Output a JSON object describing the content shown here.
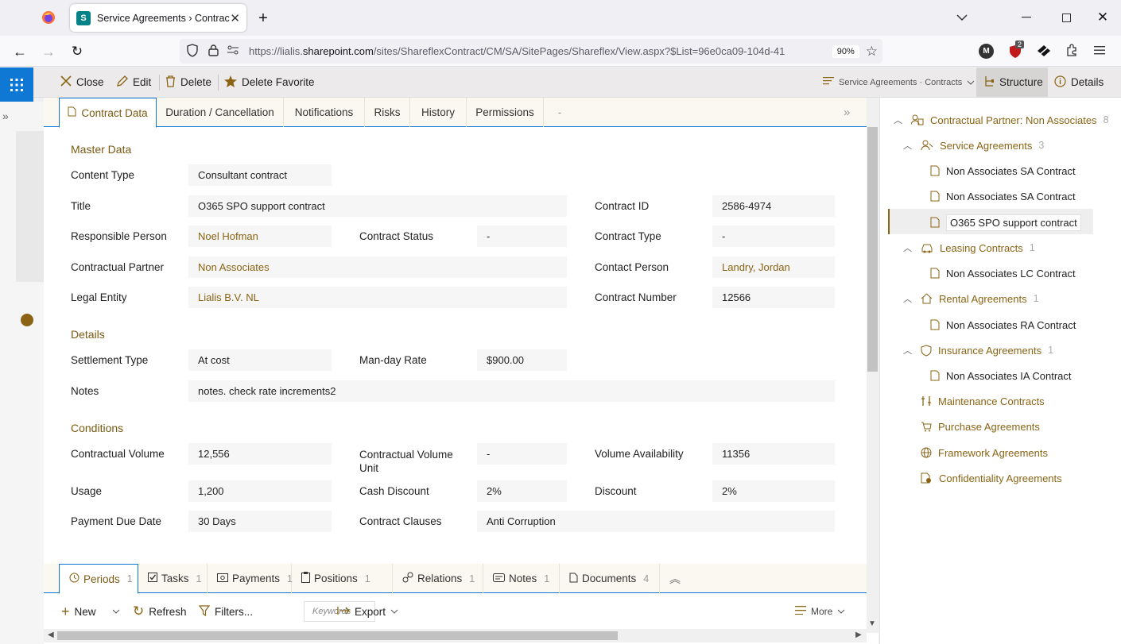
{
  "browser": {
    "tab_title": "Service Agreements › Contracts",
    "url_prefix": "https://lialis.",
    "url_domain": "sharepoint.com",
    "url_rest": "/sites/ShareflexContract/CM/SA/SitePages/Shareflex/View.aspx?$List=96e0ca09-104d-41",
    "zoom": "90%",
    "profile_initial": "M",
    "ext_badge": "2"
  },
  "command_bar": {
    "close": "Close",
    "edit": "Edit",
    "delete": "Delete",
    "delete_favorite": "Delete Favorite",
    "breadcrumb": "Service Agreements · Contracts",
    "structure": "Structure",
    "details": "Details"
  },
  "tabs": [
    "Contract Data",
    "Duration / Cancellation",
    "Notifications",
    "Risks",
    "History",
    "Permissions",
    "-"
  ],
  "sections": {
    "master": "Master Data",
    "details": "Details",
    "conditions": "Conditions"
  },
  "fields": {
    "content_type": {
      "label": "Content Type",
      "value": "Consultant contract"
    },
    "title": {
      "label": "Title",
      "value": "O365 SPO support contract"
    },
    "contract_id": {
      "label": "Contract ID",
      "value": "2586-4974"
    },
    "responsible_person": {
      "label": "Responsible Person",
      "value": "Noel Hofman"
    },
    "contract_status": {
      "label": "Contract Status",
      "value": "-"
    },
    "contract_type": {
      "label": "Contract Type",
      "value": "-"
    },
    "contractual_partner": {
      "label": "Contractual Partner",
      "value": "Non Associates"
    },
    "contact_person": {
      "label": "Contact Person",
      "value": "Landry, Jordan"
    },
    "legal_entity": {
      "label": "Legal Entity",
      "value": "Lialis B.V. NL"
    },
    "contract_number": {
      "label": "Contract Number",
      "value": "12566"
    },
    "settlement_type": {
      "label": "Settlement Type",
      "value": "At cost"
    },
    "man_day_rate": {
      "label": "Man-day Rate",
      "value": "$900.00"
    },
    "notes": {
      "label": "Notes",
      "value": "notes. check rate increments2"
    },
    "contractual_volume": {
      "label": "Contractual Volume",
      "value": "12,556"
    },
    "contractual_volume_unit": {
      "label": "Contractual Volume Unit",
      "value": "-"
    },
    "volume_availability": {
      "label": "Volume Availability",
      "value": "11356"
    },
    "usage": {
      "label": "Usage",
      "value": "1,200"
    },
    "cash_discount": {
      "label": "Cash Discount",
      "value": "2%"
    },
    "discount": {
      "label": "Discount",
      "value": "2%"
    },
    "payment_due_date": {
      "label": "Payment Due Date",
      "value": "30 Days"
    },
    "contract_clauses": {
      "label": "Contract Clauses",
      "value": "Anti Corruption"
    }
  },
  "bottom_tabs": [
    {
      "label": "Periods",
      "count": "1"
    },
    {
      "label": "Tasks",
      "count": "1"
    },
    {
      "label": "Payments",
      "count": "1"
    },
    {
      "label": "Positions",
      "count": "1"
    },
    {
      "label": "Relations",
      "count": "1"
    },
    {
      "label": "Notes",
      "count": "1"
    },
    {
      "label": "Documents",
      "count": "4"
    }
  ],
  "bottom_toolbar": {
    "new": "New",
    "refresh": "Refresh",
    "filters": "Filters...",
    "keyword_placeholder": "Keywords",
    "export": "Export",
    "more": "More"
  },
  "structure": {
    "root": {
      "label": "Contractual Partner: Non Associates",
      "count": "8"
    },
    "service": {
      "label": "Service Agreements",
      "count": "3"
    },
    "service_items": [
      "Non Associates SA Contract",
      "Non Associates SA Contract",
      "O365 SPO support contract"
    ],
    "leasing": {
      "label": "Leasing Contracts",
      "count": "1"
    },
    "leasing_item": "Non Associates LC Contract",
    "rental": {
      "label": "Rental Agreements",
      "count": "1"
    },
    "rental_item": "Non Associates RA Contract",
    "insurance": {
      "label": "Insurance Agreements",
      "count": "1"
    },
    "insurance_item": "Non Associates IA Contract",
    "maintenance": "Maintenance Contracts",
    "purchase": "Purchase Agreements",
    "framework": "Framework Agreements",
    "confidentiality": "Confidentiality Agreements"
  }
}
